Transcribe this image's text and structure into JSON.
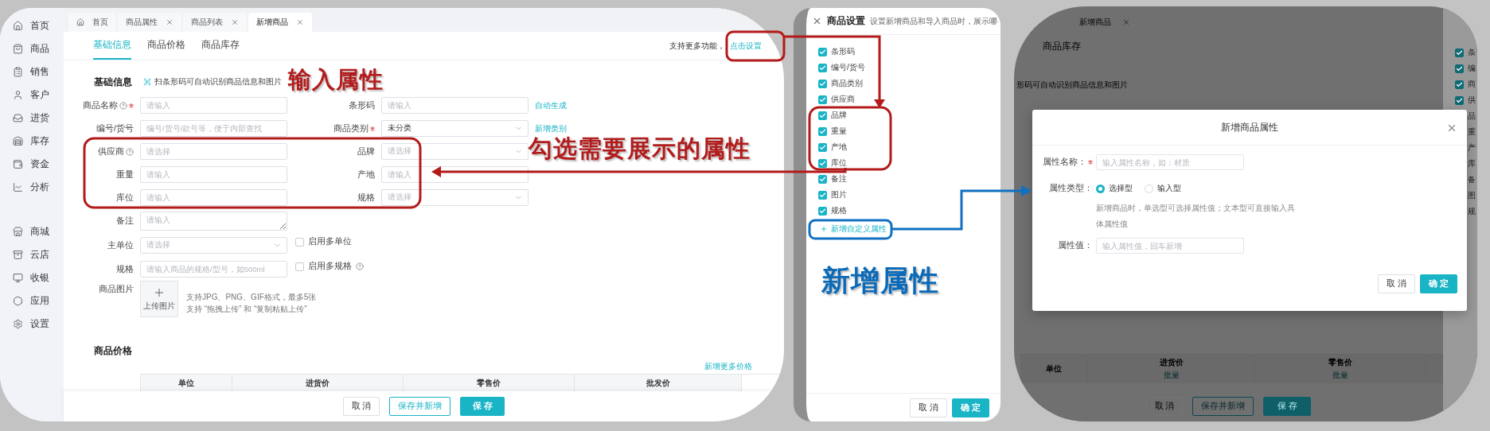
{
  "main_window": {
    "sidebar": {
      "groups": [
        [
          {
            "label": "首页"
          },
          {
            "label": "商品"
          },
          {
            "label": "销售"
          },
          {
            "label": "客户"
          },
          {
            "label": "进货"
          },
          {
            "label": "库存"
          },
          {
            "label": "资金"
          },
          {
            "label": "分析"
          }
        ],
        [
          {
            "label": "商城"
          },
          {
            "label": "云店"
          },
          {
            "label": "收银"
          },
          {
            "label": "应用"
          },
          {
            "label": "设置"
          }
        ]
      ]
    },
    "page_tabs": [
      {
        "label": "首页",
        "selected": false,
        "closable": false
      },
      {
        "label": "商品属性",
        "selected": false,
        "closable": true
      },
      {
        "label": "商品列表",
        "selected": false,
        "closable": true
      },
      {
        "label": "新增商品",
        "selected": true,
        "closable": true
      }
    ],
    "form_tabs": [
      {
        "label": "基础信息",
        "selected": true
      },
      {
        "label": "商品价格",
        "selected": false
      },
      {
        "label": "商品库存",
        "selected": false
      }
    ],
    "settings_hint": {
      "text": "支持更多功能，",
      "link": "点击设置"
    },
    "section_title": "基础信息",
    "scan_hint": "扫条形码可自动识别商品信息和图片",
    "rows": [
      {
        "fields": [
          {
            "label": "商品名称",
            "help": true,
            "required": true,
            "kind": "input",
            "placeholder": "请输入"
          },
          {
            "label": "条形码",
            "help": false,
            "required": false,
            "kind": "input",
            "placeholder": "请输入",
            "action": "自动生成"
          }
        ]
      },
      {
        "fields": [
          {
            "label": "编号/货号",
            "help": false,
            "required": false,
            "kind": "input",
            "placeholder": "编号/货号/款号等，便于内部查找"
          },
          {
            "label": "商品类别",
            "help": false,
            "required": true,
            "kind": "select",
            "value": "未分类",
            "action": "新增类别"
          }
        ]
      },
      {
        "fields": [
          {
            "label": "供应商",
            "help": true,
            "required": false,
            "kind": "input",
            "placeholder": "请选择"
          },
          {
            "label": "品牌",
            "help": false,
            "required": false,
            "kind": "select",
            "placeholder": "请选择"
          }
        ]
      },
      {
        "fields": [
          {
            "label": "重量",
            "help": false,
            "required": false,
            "kind": "input",
            "placeholder": "请输入"
          },
          {
            "label": "产地",
            "help": false,
            "required": false,
            "kind": "input",
            "placeholder": "请输入"
          }
        ]
      },
      {
        "fields": [
          {
            "label": "库位",
            "help": false,
            "required": false,
            "kind": "input",
            "placeholder": "请输入"
          },
          {
            "label": "规格",
            "help": false,
            "required": false,
            "kind": "select",
            "placeholder": "请选择"
          }
        ]
      },
      {
        "fields": [
          {
            "label": "备注",
            "help": false,
            "required": false,
            "kind": "textarea",
            "placeholder": "请输入"
          }
        ]
      },
      {
        "fields": [
          {
            "label": "主单位",
            "help": false,
            "required": false,
            "kind": "select",
            "placeholder": "请选择"
          }
        ],
        "option": {
          "label": "启用多单位",
          "checked": false,
          "help": false
        }
      },
      {
        "fields": [
          {
            "label": "规格",
            "help": false,
            "required": false,
            "kind": "input",
            "placeholder": "请输入商品的规格/型号，如500ml"
          }
        ],
        "option": {
          "label": "启用多规格",
          "checked": false,
          "help": true
        }
      },
      {
        "fields": [
          {
            "label": "商品图片",
            "help": false,
            "required": false,
            "kind": "upload",
            "button": "上传图片",
            "notes": [
              "支持JPG、PNG、GIF格式，最多5张",
              "支持 “拖拽上传” 和 “复制粘贴上传”"
            ]
          }
        ]
      }
    ],
    "price_section": {
      "title": "商品价格",
      "link": "新增更多价格",
      "columns": [
        "单位",
        "进货价",
        "零售价",
        "批发价"
      ]
    },
    "footer_buttons": [
      {
        "label": "取 消",
        "kind": "default"
      },
      {
        "label": "保存并新增",
        "kind": "outline"
      },
      {
        "label": "保 存",
        "kind": "primary"
      }
    ]
  },
  "settings_drawer": {
    "title": "商品设置",
    "subtitle": "设置新增商品和导入商品时，展示哪",
    "options": [
      {
        "label": "条形码",
        "checked": true
      },
      {
        "label": "编号/货号",
        "checked": true
      },
      {
        "label": "商品类别",
        "checked": true
      },
      {
        "label": "供应商",
        "checked": true
      },
      {
        "label": "品牌",
        "checked": true
      },
      {
        "label": "重量",
        "checked": true
      },
      {
        "label": "产地",
        "checked": true
      },
      {
        "label": "库位",
        "checked": true
      },
      {
        "label": "备注",
        "checked": true
      },
      {
        "label": "图片",
        "checked": true
      },
      {
        "label": "规格",
        "checked": true
      }
    ],
    "add_link": "新增自定义属性",
    "buttons": [
      {
        "label": "取 消",
        "kind": "default"
      },
      {
        "label": "确 定",
        "kind": "primary"
      }
    ]
  },
  "dialog_screen": {
    "background": {
      "tab": "新增商品",
      "form_tab": "商品库存",
      "scan_hint": "形码可自动识别商品信息和图片",
      "columns": [
        {
          "label": "单位"
        },
        {
          "label": "进货价",
          "action": "批量"
        },
        {
          "label": "零售价",
          "action": "批量"
        }
      ],
      "buttons": [
        {
          "label": "取 消",
          "kind": "default"
        },
        {
          "label": "保存并新增",
          "kind": "outline"
        },
        {
          "label": "保 存",
          "kind": "primary"
        }
      ],
      "side_options": [
        {
          "label": "条",
          "checked": true
        },
        {
          "label": "编",
          "checked": true
        },
        {
          "label": "商",
          "checked": true
        },
        {
          "label": "供",
          "checked": true
        },
        {
          "label": "品"
        },
        {
          "label": "重"
        },
        {
          "label": "产"
        },
        {
          "label": "库"
        },
        {
          "label": "备"
        },
        {
          "label": "图"
        },
        {
          "label": "规"
        }
      ]
    },
    "dialog": {
      "title": "新增商品属性",
      "name_field": {
        "label": "属性名称：",
        "required": true,
        "placeholder": "输入属性名称，如：材质"
      },
      "type_field": {
        "label": "属性类型：",
        "options": [
          {
            "label": "选择型",
            "selected": true
          },
          {
            "label": "输入型",
            "selected": false
          }
        ],
        "hint": "新增商品时，单选型可选择属性值；文本型可直接输入具体属性值"
      },
      "value_field": {
        "label": "属性值：",
        "placeholder": "输入属性值，回车新增"
      },
      "buttons": [
        {
          "label": "取 消",
          "kind": "default"
        },
        {
          "label": "确 定",
          "kind": "primary"
        }
      ]
    }
  },
  "annotations": [
    {
      "text": "输入属性",
      "color": "#b31b1b"
    },
    {
      "text": "勾选需要展示的属性",
      "color": "#b31b1b"
    },
    {
      "text": "新增属性",
      "color": "#0a6ab8"
    }
  ]
}
